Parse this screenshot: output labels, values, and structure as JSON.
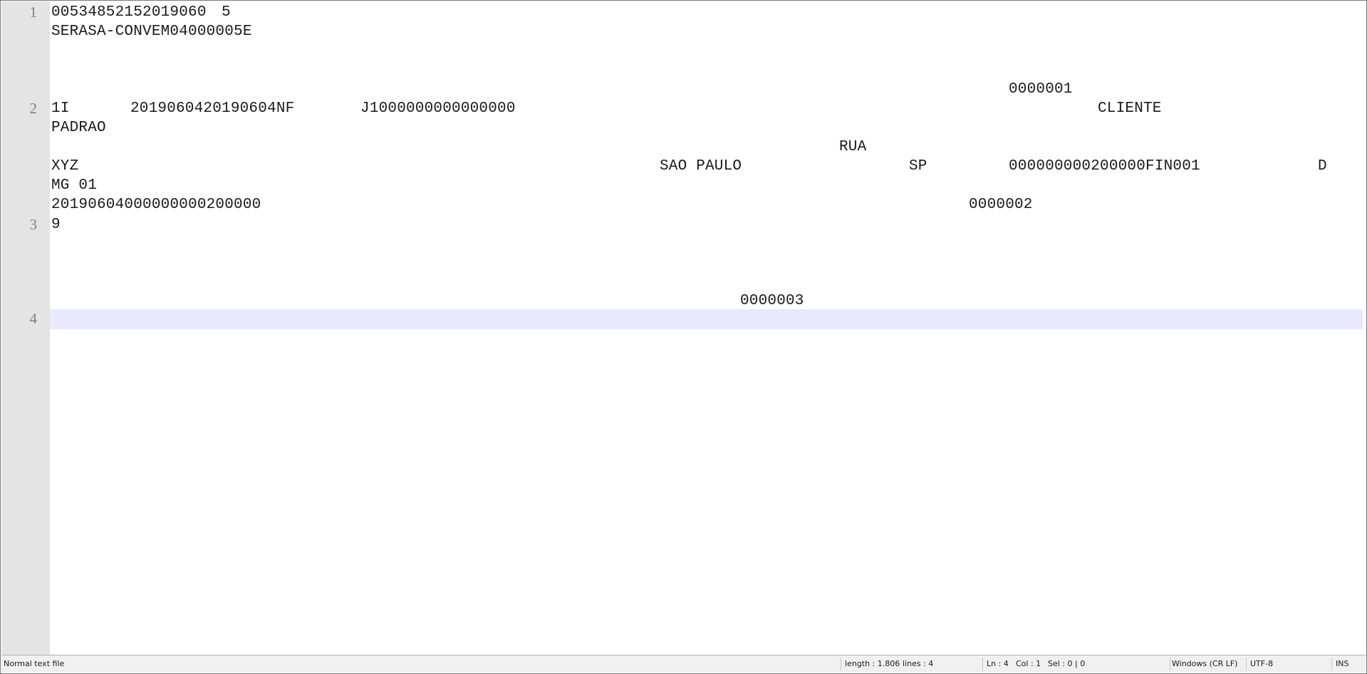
{
  "editor": {
    "line_numbers": [
      "1",
      "2",
      "3",
      "4"
    ],
    "segments": {
      "l1_a": "00534852152019060",
      "l1_b": "5",
      "l1_c": "SERASA-CONVEM04000005E",
      "l1_d": "0000001",
      "l2_a": "1I",
      "l2_b": "2019060420190604NF",
      "l2_c": "J1000000000000000",
      "l2_d": "CLIENTE",
      "l2_e": "PADRAO",
      "l2_f": "RUA",
      "l2_g": "XYZ",
      "l2_h": "SAO PAULO",
      "l2_i": "SP",
      "l2_j": "000000000200000FIN001",
      "l2_k": "D",
      "l2_l": "MG 01",
      "l2_m": "20190604000000000200000",
      "l2_n": "0000002",
      "l3_a": "9",
      "l3_b": "0000003"
    }
  },
  "status_bar": {
    "file_type": "Normal text file",
    "length": "length : 1.806",
    "lines": "lines : 4",
    "ln": "Ln : 4",
    "col": "Col : 1",
    "sel": "Sel : 0 | 0",
    "eol": "Windows (CR LF)",
    "encoding": "UTF-8",
    "mode": "INS"
  },
  "colors": {
    "gutter": "#e4e4e4",
    "current_line": "#e8e8ff",
    "line_number": "#808080",
    "status_bar": "#f0f0f0"
  }
}
